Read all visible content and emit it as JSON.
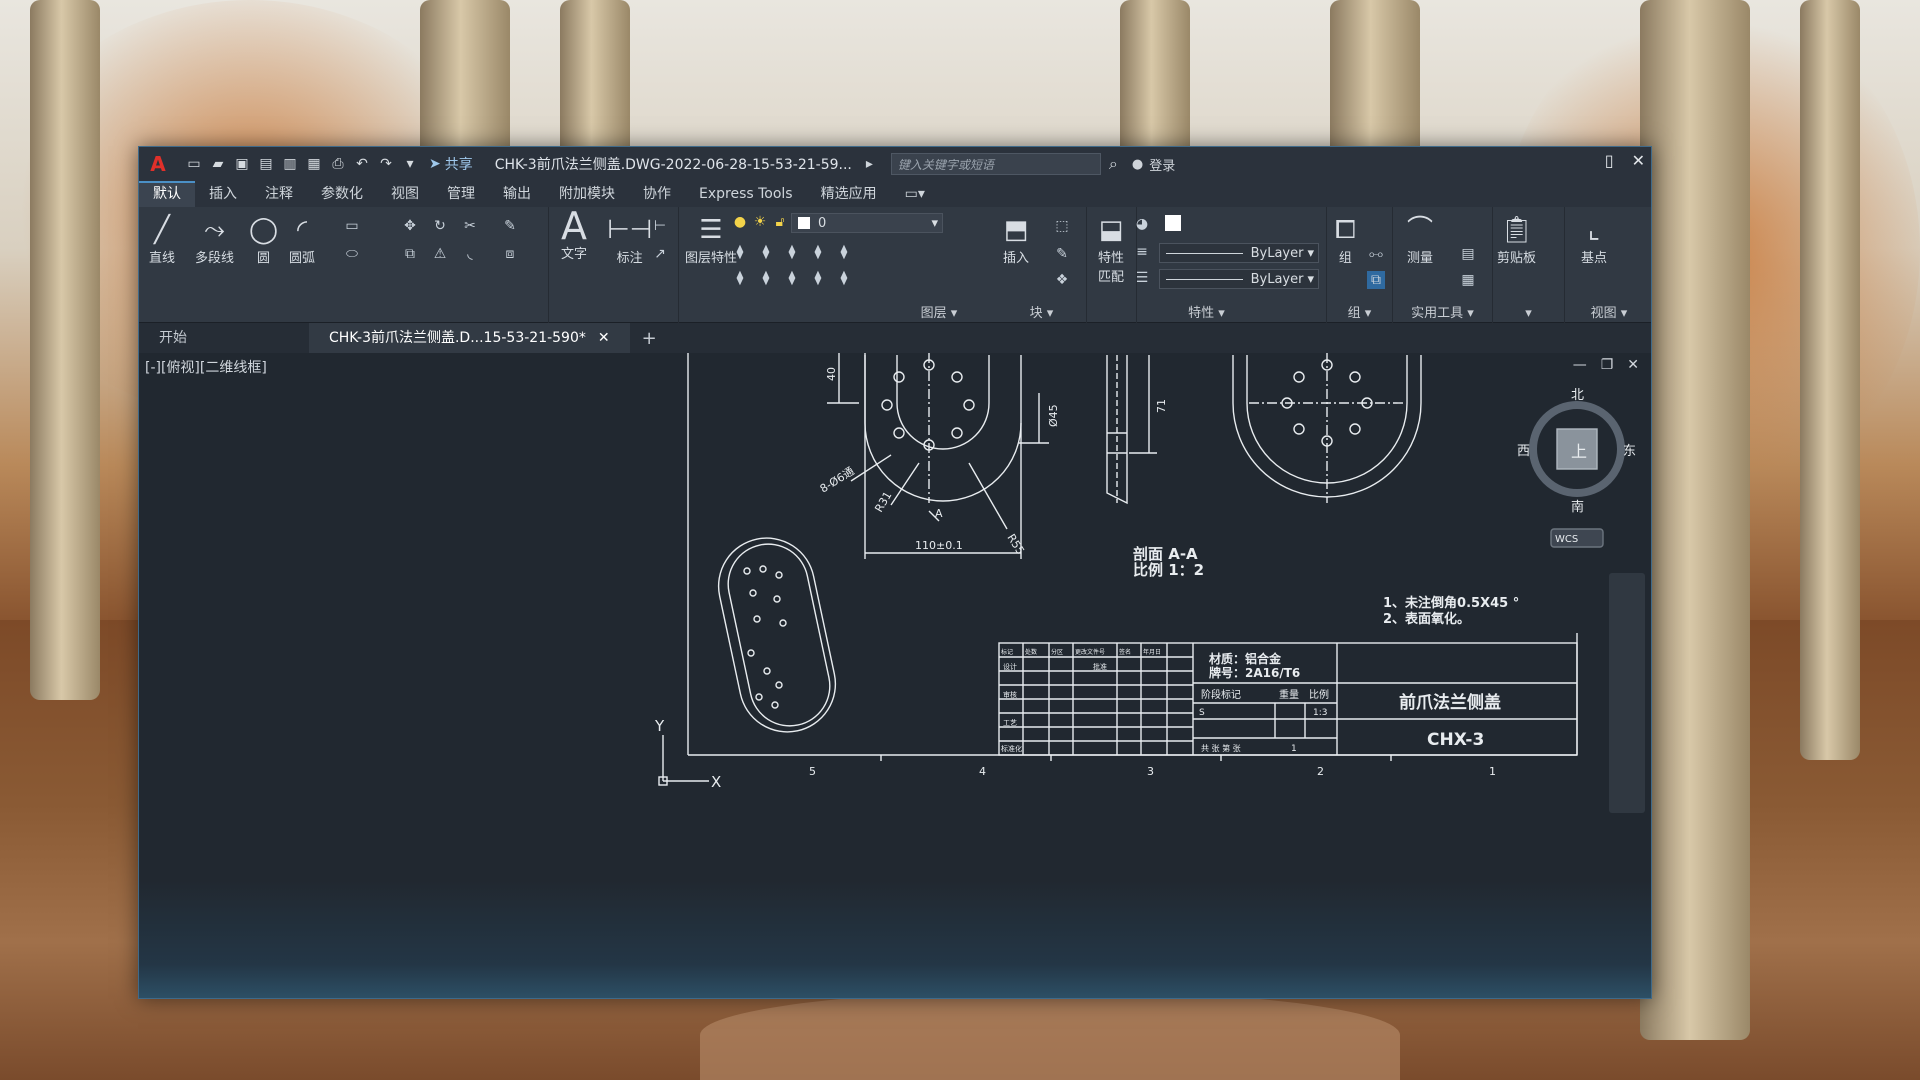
{
  "app": {
    "title": "CHK-3前爪法兰侧盖.DWG-2022-06-28-15-53-21-59...",
    "share_label": "共享",
    "search_placeholder": "键入关键字或短语",
    "login_label": "登录"
  },
  "menubar": {
    "tabs": [
      "默认",
      "插入",
      "注释",
      "参数化",
      "视图",
      "管理",
      "输出",
      "附加模块",
      "协作",
      "Express Tools",
      "精选应用"
    ]
  },
  "ribbon": {
    "draw": {
      "line": "直线",
      "polyline": "多段线",
      "circle": "圆",
      "arc": "圆弧"
    },
    "annotation": {
      "text": "文字",
      "dimension": "标注"
    },
    "layers": {
      "layer_props": "图层特性",
      "layer_value": "0",
      "label": "图层"
    },
    "block": {
      "insert": "插入",
      "label": "块"
    },
    "properties": {
      "match": "特性匹配",
      "bylayer1": "ByLayer",
      "bylayer2": "ByLayer",
      "label": "特性"
    },
    "groups": {
      "group": "组",
      "label": "组"
    },
    "utilities": {
      "measure": "测量",
      "label": "实用工具"
    },
    "clipboard": {
      "label": "剪贴板"
    },
    "view": {
      "base": "基点",
      "label": "视图"
    }
  },
  "filetabs": {
    "start": "开始",
    "active": "CHK-3前爪法兰侧盖.D...15-53-21-590*"
  },
  "viewport": {
    "label": "[-][俯视][二维线框]",
    "viewcube": {
      "top": "上",
      "north": "北",
      "south": "南",
      "east": "东",
      "west": "西",
      "wcs": "WCS"
    }
  },
  "drawing": {
    "dims": {
      "d40": "40",
      "d45": "Ø45",
      "d71": "71",
      "holes": "8-Ø6通",
      "r31": "R31",
      "r55": "R55",
      "w110": "110±0.1",
      "a_mark": "A"
    },
    "section": {
      "title": "剖面 A-A",
      "scale": "比例 1：2"
    },
    "notes": [
      "1、未注倒角0.5X45 °",
      "2、表面氧化。"
    ],
    "titleblock": {
      "material": "材质：铝合金",
      "grade": "牌号：2A16/T6",
      "part_name": "前爪法兰侧盖",
      "part_code": "CHX-3",
      "stage": "阶段标记",
      "weight": "重量",
      "ratio": "比例",
      "ratio_value": "1:3",
      "sheets": "共 张 第 张",
      "sheet_no": "1",
      "stage_value": "S",
      "headers": [
        "标记",
        "处数",
        "分区",
        "更改文件号",
        "签名",
        "年月日"
      ],
      "rows": [
        "设计",
        "审核",
        "工艺",
        "标准化"
      ],
      "approve": "批准"
    },
    "ruler": [
      "5",
      "4",
      "3",
      "2",
      "1"
    ],
    "ucs": {
      "x": "X",
      "y": "Y"
    }
  },
  "colors": {
    "accent": "#4b90c6",
    "canvas": "#212830",
    "line": "#e8ecef"
  }
}
